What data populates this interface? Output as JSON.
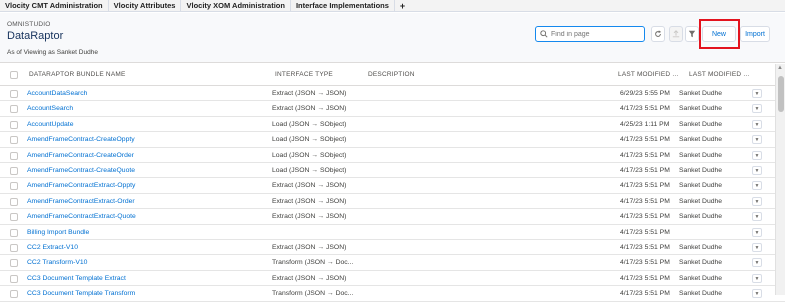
{
  "tabs": [
    "Vlocity CMT Administration",
    "Vlocity Attributes",
    "Vlocity XOM Administration",
    "Interface Implementations",
    "+"
  ],
  "header": {
    "eyebrow": "OMNISTUDIO",
    "title": "DataRaptor",
    "subtitle": "As of   Viewing as Sanket Dudhe"
  },
  "search": {
    "placeholder": "Find in page"
  },
  "buttons": {
    "new": "New",
    "import": "Import"
  },
  "columns": {
    "name": "DATARAPTOR BUNDLE NAME",
    "interface_type": "INTERFACE TYPE",
    "description": "DESCRIPTION",
    "last_modified": "LAST MODIFIED ...",
    "last_modified_by": "LAST MODIFIED ..."
  },
  "rows": [
    {
      "name": "AccountDataSearch",
      "type": "Extract (JSON → JSON)",
      "modified": "6/29/23 5:55 PM",
      "by": "Sanket Dudhe"
    },
    {
      "name": "AccountSearch",
      "type": "Extract (JSON → JSON)",
      "modified": "4/17/23 5:51 PM",
      "by": "Sanket Dudhe"
    },
    {
      "name": "AccountUpdate",
      "type": "Load (JSON → SObject)",
      "modified": "4/25/23 1:11 PM",
      "by": "Sanket Dudhe"
    },
    {
      "name": "AmendFrameContract-CreateOppty",
      "type": "Load (JSON → SObject)",
      "modified": "4/17/23 5:51 PM",
      "by": "Sanket Dudhe"
    },
    {
      "name": "AmendFrameContract-CreateOrder",
      "type": "Load (JSON → SObject)",
      "modified": "4/17/23 5:51 PM",
      "by": "Sanket Dudhe"
    },
    {
      "name": "AmendFrameContract-CreateQuote",
      "type": "Load (JSON → SObject)",
      "modified": "4/17/23 5:51 PM",
      "by": "Sanket Dudhe"
    },
    {
      "name": "AmendFrameContractExtract-Oppty",
      "type": "Extract (JSON → JSON)",
      "modified": "4/17/23 5:51 PM",
      "by": "Sanket Dudhe"
    },
    {
      "name": "AmendFrameContractExtract-Order",
      "type": "Extract (JSON → JSON)",
      "modified": "4/17/23 5:51 PM",
      "by": "Sanket Dudhe"
    },
    {
      "name": "AmendFrameContractExtract-Quote",
      "type": "Extract (JSON → JSON)",
      "modified": "4/17/23 5:51 PM",
      "by": "Sanket Dudhe"
    },
    {
      "name": "Billing Import Bundle",
      "type": "",
      "modified": "4/17/23 5:51 PM",
      "by": ""
    },
    {
      "name": "CC2 Extract-V10",
      "type": "Extract (JSON → JSON)",
      "modified": "4/17/23 5:51 PM",
      "by": "Sanket Dudhe"
    },
    {
      "name": "CC2 Transform-V10",
      "type": "Transform (JSON → Doc...",
      "modified": "4/17/23 5:51 PM",
      "by": "Sanket Dudhe"
    },
    {
      "name": "CC3 Document Template Extract",
      "type": "Extract (JSON → JSON)",
      "modified": "4/17/23 5:51 PM",
      "by": "Sanket Dudhe"
    },
    {
      "name": "CC3 Document Template Transform",
      "type": "Transform (JSON → Doc...",
      "modified": "4/17/23 5:51 PM",
      "by": "Sanket Dudhe"
    }
  ],
  "colors": {
    "link": "#0070d2",
    "highlight": "#e3131e"
  }
}
